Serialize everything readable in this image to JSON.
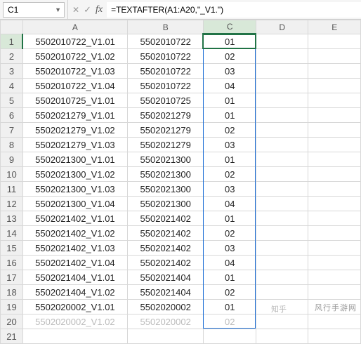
{
  "formula_bar": {
    "cell_ref": "C1",
    "formula": "=TEXTAFTER(A1:A20,\"_V1.\")"
  },
  "columns": [
    "A",
    "B",
    "C",
    "D",
    "E"
  ],
  "active_column_index": 2,
  "active_row_index": 0,
  "rows": [
    {
      "n": "1",
      "a": "5502010722_V1.01",
      "b": "5502010722",
      "c": "01",
      "faded": false
    },
    {
      "n": "2",
      "a": "5502010722_V1.02",
      "b": "5502010722",
      "c": "02",
      "faded": false
    },
    {
      "n": "3",
      "a": "5502010722_V1.03",
      "b": "5502010722",
      "c": "03",
      "faded": false
    },
    {
      "n": "4",
      "a": "5502010722_V1.04",
      "b": "5502010722",
      "c": "04",
      "faded": false
    },
    {
      "n": "5",
      "a": "5502010725_V1.01",
      "b": "5502010725",
      "c": "01",
      "faded": false
    },
    {
      "n": "6",
      "a": "5502021279_V1.01",
      "b": "5502021279",
      "c": "01",
      "faded": false
    },
    {
      "n": "7",
      "a": "5502021279_V1.02",
      "b": "5502021279",
      "c": "02",
      "faded": false
    },
    {
      "n": "8",
      "a": "5502021279_V1.03",
      "b": "5502021279",
      "c": "03",
      "faded": false
    },
    {
      "n": "9",
      "a": "5502021300_V1.01",
      "b": "5502021300",
      "c": "01",
      "faded": false
    },
    {
      "n": "10",
      "a": "5502021300_V1.02",
      "b": "5502021300",
      "c": "02",
      "faded": false
    },
    {
      "n": "11",
      "a": "5502021300_V1.03",
      "b": "5502021300",
      "c": "03",
      "faded": false
    },
    {
      "n": "12",
      "a": "5502021300_V1.04",
      "b": "5502021300",
      "c": "04",
      "faded": false
    },
    {
      "n": "13",
      "a": "5502021402_V1.01",
      "b": "5502021402",
      "c": "01",
      "faded": false
    },
    {
      "n": "14",
      "a": "5502021402_V1.02",
      "b": "5502021402",
      "c": "02",
      "faded": false
    },
    {
      "n": "15",
      "a": "5502021402_V1.03",
      "b": "5502021402",
      "c": "03",
      "faded": false
    },
    {
      "n": "16",
      "a": "5502021402_V1.04",
      "b": "5502021402",
      "c": "04",
      "faded": false
    },
    {
      "n": "17",
      "a": "5502021404_V1.01",
      "b": "5502021404",
      "c": "01",
      "faded": false
    },
    {
      "n": "18",
      "a": "5502021404_V1.02",
      "b": "5502021404",
      "c": "02",
      "faded": false
    },
    {
      "n": "19",
      "a": "5502020002_V1.01",
      "b": "5502020002",
      "c": "01",
      "faded": false
    },
    {
      "n": "20",
      "a": "5502020002_V1.02",
      "b": "5502020002",
      "c": "02",
      "faded": true
    },
    {
      "n": "21",
      "a": "",
      "b": "",
      "c": "",
      "faded": false
    }
  ],
  "watermark": "风行手游网",
  "zhihu_tag": "知乎"
}
